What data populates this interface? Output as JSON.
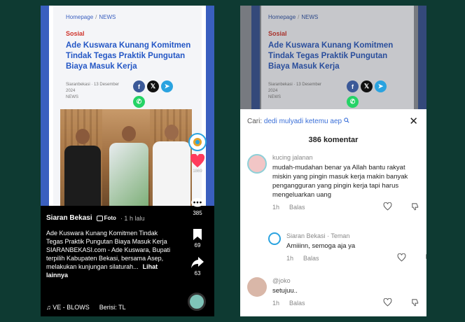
{
  "left": {
    "article": {
      "breadcrumb_home": "Homepage",
      "breadcrumb_sep": "/",
      "breadcrumb_news": "NEWS",
      "category": "Sosial",
      "headline": "Ade Kuswara Kunang Komitmen Tindak Tegas Praktik Pungutan Biaya Masuk Kerja",
      "meta_line1": "Siaranbekasi  ·  13 Desember",
      "meta_line2": "2024",
      "meta_line3": "NEWS"
    },
    "post": {
      "author": "Siaran Bekasi",
      "badge": "Foto",
      "time": "· 1 h lalu",
      "caption": "Ade Kuswara Kunang Komitmen Tindak Tegas Praktik Pungutan Biaya Masuk Kerja SIARANBEKASI.com - Ade Kuswara, Bupati terpilih Kabupaten Bekasi, bersama Asep, melakukan kunjungan silaturah...",
      "more": "Lihat lainnya",
      "music": "♫ VE - BLOWS",
      "music2": "Berisi: TL"
    },
    "sidebar": {
      "comments": "385",
      "saves": "69",
      "shares": "63",
      "like_label": "1869"
    }
  },
  "right": {
    "article": {
      "breadcrumb_home": "Homepage",
      "breadcrumb_sep": "/",
      "breadcrumb_news": "NEWS",
      "category": "Sosial",
      "headline": "Ade Kuswara Kunang Komitmen Tindak Tegas Praktik Pungutan Biaya Masuk Kerja",
      "meta_line1": "Siaranbekasi  ·  13 Desember",
      "meta_line2": "2024",
      "meta_line3": "NEWS"
    },
    "comments_panel": {
      "search_label": "Cari:",
      "search_query": "dedi mulyadi ketemu aep",
      "count": "386 komentar",
      "reply_label": "Balas",
      "items": [
        {
          "user": "kucing jalanan",
          "text": "mudah-mudahan benar ya Allah bantu rakyat miskin yang pingin masuk kerja makin banyak pengangguran yang pingin kerja tapi harus mengeluarkan uang",
          "time": "1h"
        },
        {
          "user": "Siaran Bekasi · Teman",
          "text": "Amiiinn, semoga aja ya",
          "time": "1h"
        },
        {
          "user": "@joko",
          "text": "setujuu..",
          "time": "1h"
        }
      ]
    }
  },
  "colors": {
    "background": "#0e3a32",
    "accent_blue": "#2457c5",
    "category_red": "#d0342c",
    "like_red": "#ff3b5c"
  }
}
